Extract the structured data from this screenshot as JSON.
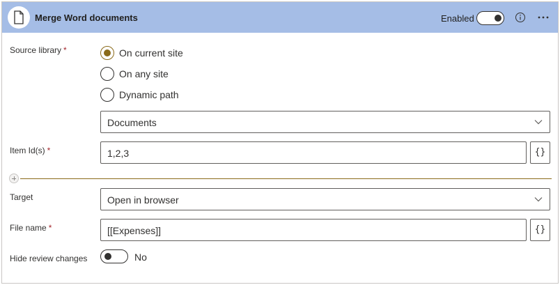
{
  "header": {
    "title": "Merge Word documents",
    "enabled_label": "Enabled",
    "enabled": true,
    "icon": "document-icon"
  },
  "source_library": {
    "label": "Source library",
    "required_mark": "*",
    "options": [
      {
        "label": "On current site",
        "selected": true
      },
      {
        "label": "On any site",
        "selected": false
      },
      {
        "label": "Dynamic path",
        "selected": false
      }
    ],
    "library_value": "Documents"
  },
  "item_ids": {
    "label": "Item Id(s)",
    "required_mark": "*",
    "value": "1,2,3",
    "expression_button": "{}"
  },
  "target": {
    "label": "Target",
    "value": "Open in browser"
  },
  "file_name": {
    "label": "File name",
    "required_mark": "*",
    "value": "[[Expenses]]",
    "expression_button": "{}"
  },
  "hide_review_changes": {
    "label": "Hide review changes",
    "value": "No",
    "enabled": false
  },
  "colors": {
    "header_bg": "#a5bde6",
    "accent": "#8a6a19",
    "required": "#a4262c"
  }
}
